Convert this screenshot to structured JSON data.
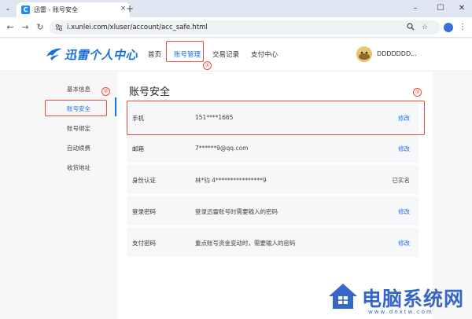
{
  "browser": {
    "tab_title": "迅雷 - 账号安全",
    "tab_favicon": "C",
    "url": "i.xunlei.com/xluser/account/acc_safe.html",
    "new_tab": "+",
    "win_minimize": "–",
    "win_maximize": "☐",
    "win_close": "✕"
  },
  "header": {
    "logo_text": "迅雷个人中心",
    "nav": [
      {
        "label": "首页"
      },
      {
        "label": "账号管理"
      },
      {
        "label": "交易记录"
      },
      {
        "label": "支付中心"
      }
    ],
    "username": "DDDDDDD..."
  },
  "sidebar": {
    "items": [
      {
        "label": "基本信息"
      },
      {
        "label": "账号安全"
      },
      {
        "label": "账号绑定"
      },
      {
        "label": "自动续费"
      },
      {
        "label": "收货地址"
      }
    ]
  },
  "main": {
    "title": "账号安全",
    "rows": [
      {
        "label": "手机",
        "value": "151****1665",
        "action": "修改"
      },
      {
        "label": "邮箱",
        "value": "7******9@qq.com",
        "action": "修改"
      },
      {
        "label": "身份认证",
        "value": "林*钧 4****************9",
        "action": "已实名"
      },
      {
        "label": "登录密码",
        "value": "登录迅雷账号时需要输入的密码",
        "action": "修改"
      },
      {
        "label": "支付密码",
        "value": "重点账号资金变动时，需要输入的密码",
        "action": "修改"
      }
    ]
  },
  "annotations": {
    "one": "①",
    "two": "②",
    "three": "③"
  },
  "watermark": {
    "text": "电脑系统网",
    "url": "www.dnxtw.com"
  },
  "colors": {
    "accent": "#1a72e8",
    "annotation": "#e74c3c",
    "watermark": "#3566c8"
  }
}
